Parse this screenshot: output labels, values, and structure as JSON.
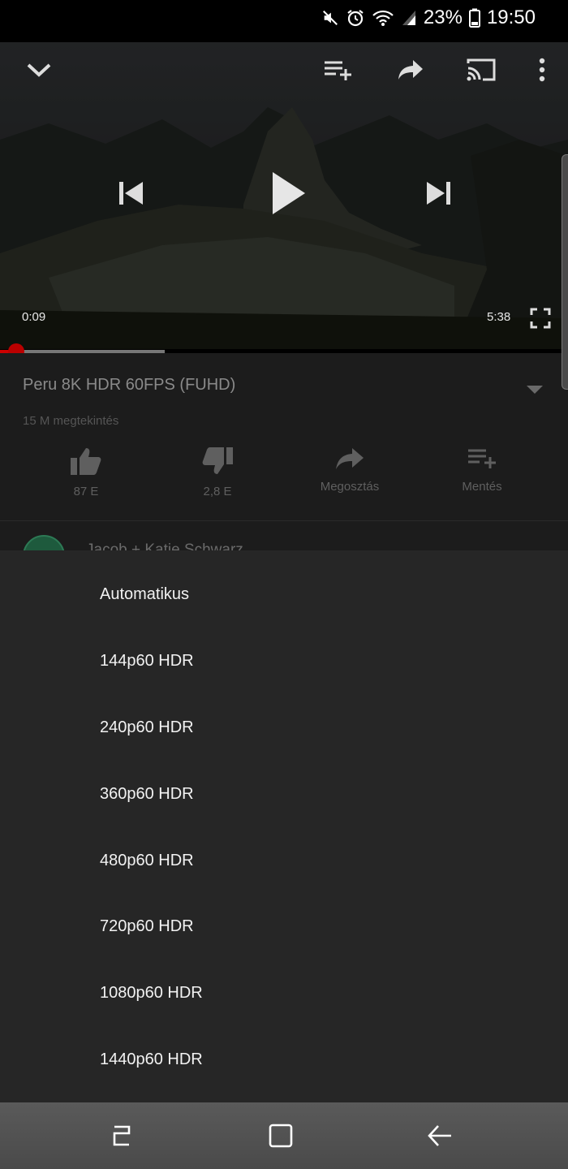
{
  "status_bar": {
    "battery": "23%",
    "time": "19:50",
    "icons": [
      "mute-icon",
      "alarm-icon",
      "wifi-icon",
      "signal-icon",
      "battery-icon"
    ]
  },
  "player": {
    "current_time": "0:09",
    "duration": "5:38",
    "progress": 0.028,
    "buffered": 0.29,
    "controls": [
      "collapse-icon",
      "add-to-queue-icon",
      "share-icon",
      "cast-icon",
      "more-vert-icon",
      "previous-icon",
      "play-icon",
      "next-icon",
      "fullscreen-icon"
    ]
  },
  "video": {
    "title": "Peru 8K HDR 60FPS (FUHD)",
    "views": "15 M megtekintés",
    "actions": [
      {
        "icon": "thumb-up-icon",
        "label": "87 E"
      },
      {
        "icon": "thumb-down-icon",
        "label": "2,8 E"
      },
      {
        "icon": "share-icon",
        "label": "Megosztás"
      },
      {
        "icon": "save-playlist-icon",
        "label": "Mentés"
      }
    ],
    "channel": "Jacob + Katie Schwarz"
  },
  "quality_menu": {
    "options": [
      "Automatikus",
      "144p60 HDR",
      "240p60 HDR",
      "360p60 HDR",
      "480p60 HDR",
      "720p60 HDR",
      "1080p60 HDR",
      "1440p60 HDR"
    ]
  },
  "nav_bar": {
    "buttons": [
      "recents-icon",
      "home-icon",
      "back-icon"
    ]
  }
}
